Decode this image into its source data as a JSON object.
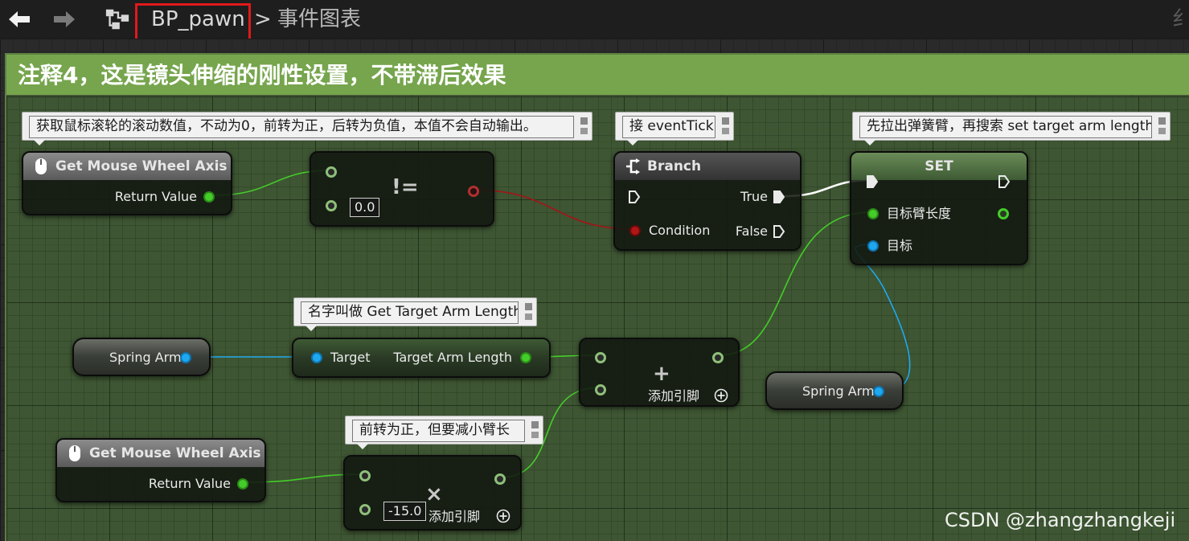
{
  "toolbar": {
    "back_icon": "arrow-left-icon",
    "forward_icon": "arrow-right-icon",
    "graph_icon": "blueprint-graph-icon",
    "breadcrumb_blueprint": "BP_pawn",
    "breadcrumb_separator": ">",
    "breadcrumb_page": "事件图表",
    "right_clipped_text": "纟"
  },
  "comment_group": {
    "title": "注释4，这是镜头伸缩的刚性设置，不带滞后效果",
    "color": "#76a54d"
  },
  "bubbles": {
    "wheel_note": "获取鼠标滚轮的滚动数值，不动为0，前转为正，后转为负值，本值不会自动输出。",
    "tick_note": "接 eventTick",
    "set_note": "先拉出弹簧臂，再搜索 set target arm length",
    "target_note": "名字叫做 Get Target Arm Length",
    "multiply_note": "前转为正，但要减小臂长"
  },
  "nodes": {
    "mouse_wheel_1": {
      "title": "Get Mouse Wheel Axis",
      "icon": "mouse-icon",
      "output": "Return Value"
    },
    "not_equal": {
      "symbol": "!=",
      "value_b": "0.0"
    },
    "branch": {
      "title": "Branch",
      "icon": "branch-icon",
      "condition": "Condition",
      "true_label": "True",
      "false_label": "False"
    },
    "set": {
      "title": "SET",
      "pin_value": "目标臂长度",
      "pin_target": "目标"
    },
    "spring_arm_1": {
      "label": "Spring Arm"
    },
    "get_target_arm": {
      "input": "Target",
      "output": "Target Arm Length"
    },
    "add": {
      "symbol": "+",
      "add_pin": "添加引脚"
    },
    "spring_arm_2": {
      "label": "Spring Arm"
    },
    "mouse_wheel_2": {
      "title": "Get Mouse Wheel Axis",
      "icon": "mouse-icon",
      "output": "Return Value"
    },
    "multiply": {
      "symbol": "×",
      "value_b": "-15.0",
      "add_pin": "添加引脚"
    }
  },
  "colors": {
    "float_pin": "#44cc2a",
    "object_pin": "#1ea8f0",
    "bool_pin": "#b01616",
    "exec_wire": "#ffffff"
  },
  "watermark": "CSDN @zhangzhangkeji"
}
